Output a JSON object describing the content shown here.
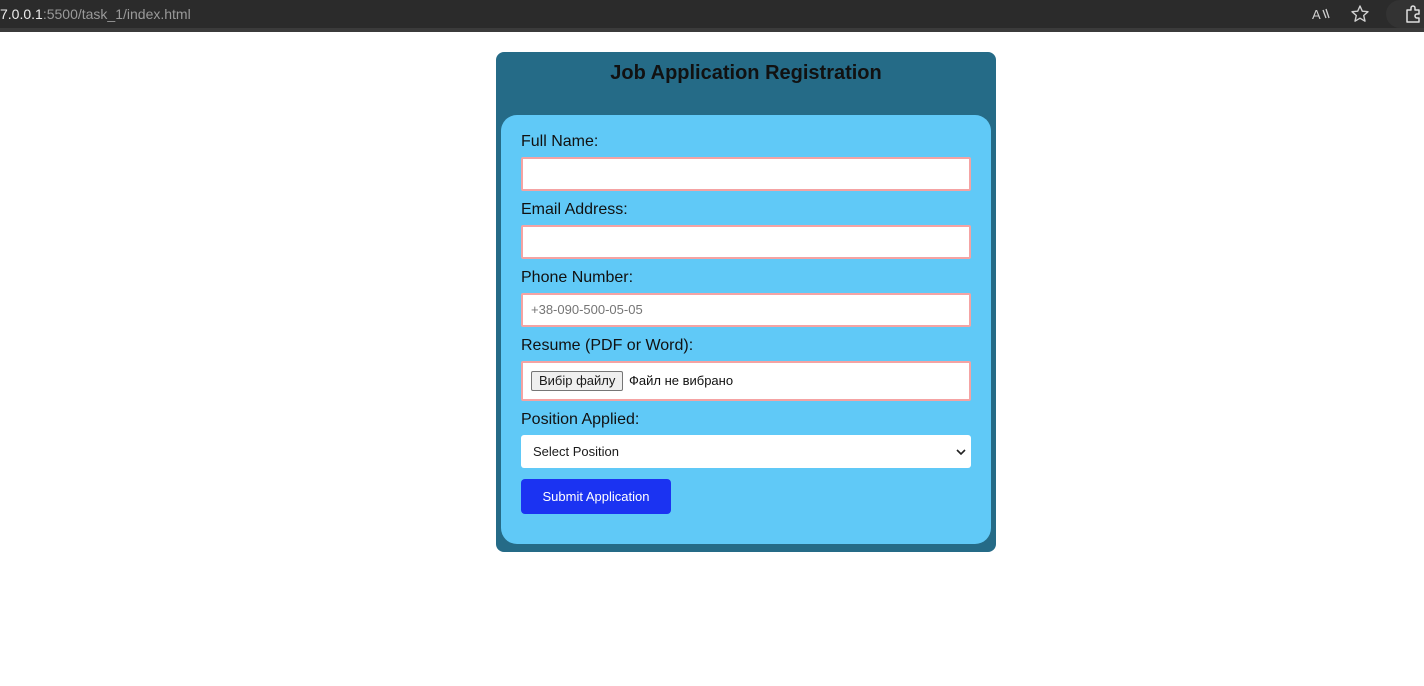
{
  "browser": {
    "url_host": "7.0.0.1",
    "url_path": ":5500/task_1/index.html"
  },
  "form": {
    "title": "Job Application Registration",
    "full_name_label": "Full Name:",
    "email_label": "Email Address:",
    "phone_label": "Phone Number:",
    "phone_placeholder": "+38-090-500-05-05",
    "resume_label": "Resume (PDF or Word):",
    "file_button_label": "Вибір файлу",
    "file_status": "Файл не вибрано",
    "position_label": "Position Applied:",
    "position_selected": "Select Position",
    "submit_label": "Submit Application"
  },
  "colors": {
    "card_outer": "#256b87",
    "card_inner": "#60c9f7",
    "field_border": "#f5a3a3",
    "submit_bg": "#1b33f2"
  }
}
